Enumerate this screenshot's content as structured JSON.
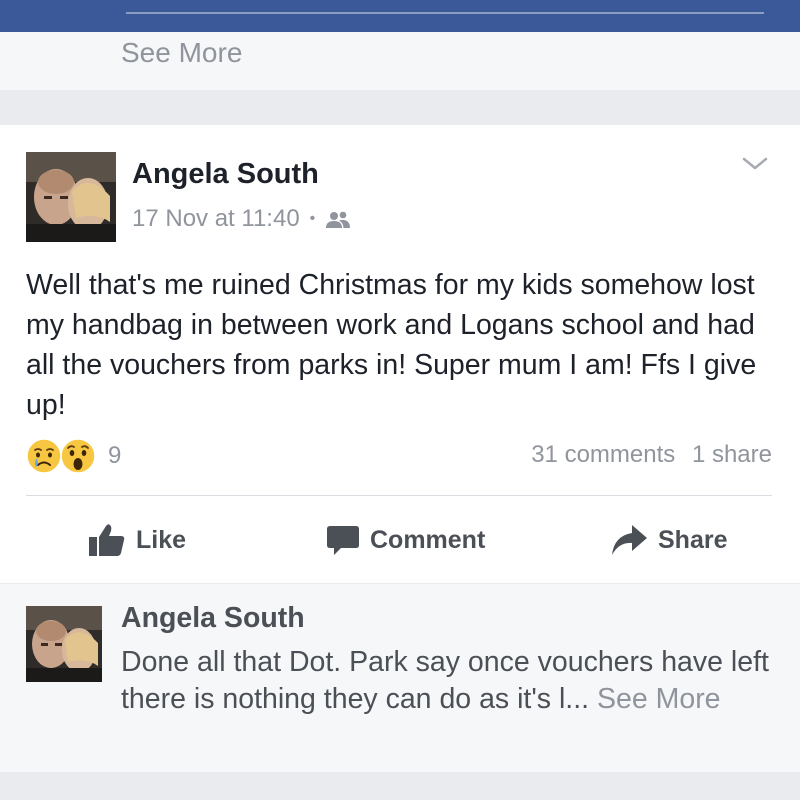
{
  "previous_card": {
    "see_more": "See More"
  },
  "post": {
    "author": "Angela South",
    "timestamp": "17 Nov at 11:40",
    "separator": "•",
    "audience_icon": "friends-icon",
    "menu_icon": "chevron-down-icon",
    "text": "Well that's me ruined Christmas for my kids somehow lost my handbag in between work and Logans school and had all the vouchers from parks in! Super mum I am! Ffs I give up!",
    "reactions": [
      "sad-reaction-icon",
      "wow-reaction-icon"
    ],
    "reaction_count": "9",
    "comments_count": "31 comments",
    "shares_count": "1 share",
    "actions": {
      "like": "Like",
      "comment": "Comment",
      "share": "Share"
    }
  },
  "comment_preview": {
    "author": "Angela South",
    "text": "Done all that Dot. Park say once vouchers have left there is nothing they can do as it's l...",
    "see_more": "See More"
  },
  "colors": {
    "brand_blue": "#3b5998",
    "text_primary": "#1d2129",
    "text_secondary": "#90949c",
    "action_text": "#4b4f56",
    "card_bg": "#ffffff",
    "feed_bg": "#e9ebee"
  }
}
